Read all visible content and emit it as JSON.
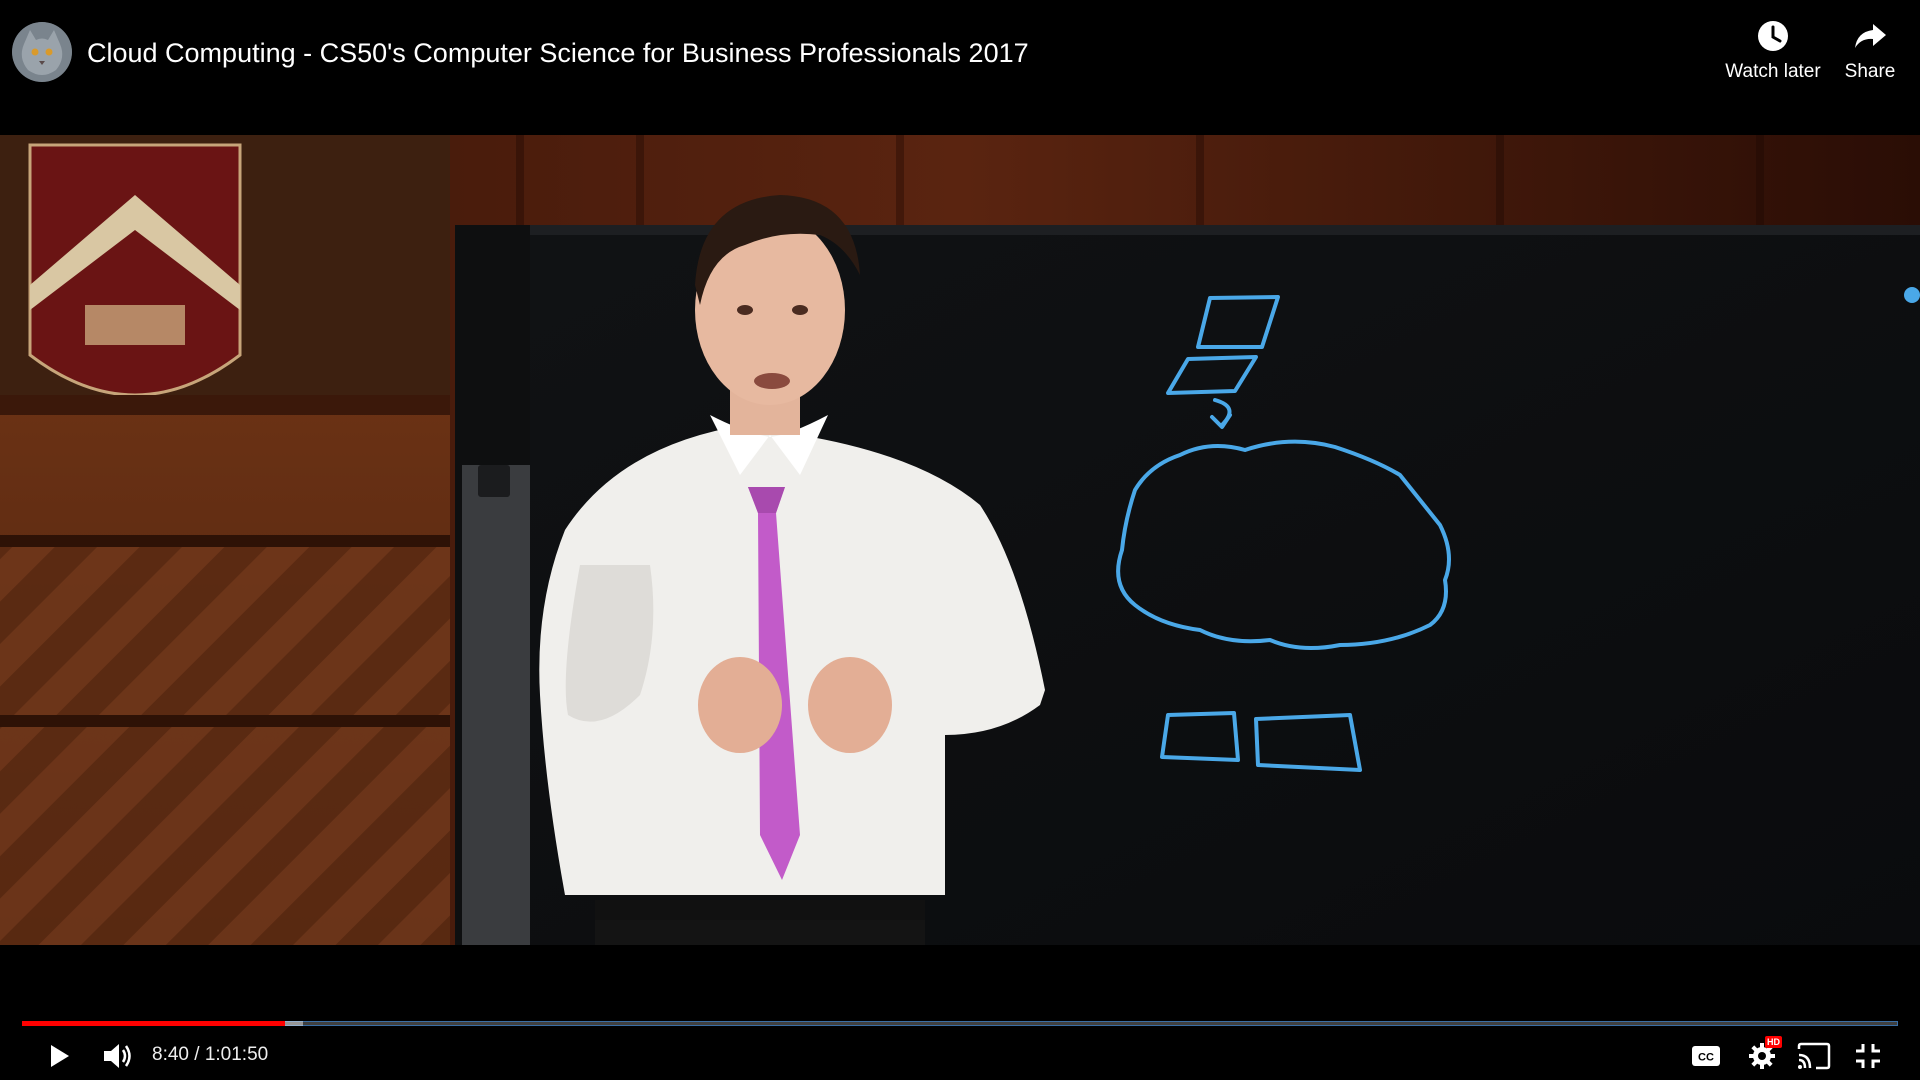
{
  "video": {
    "title": "Cloud Computing - CS50's Computer Science for Business Professionals 2017"
  },
  "top_actions": {
    "watch_later": {
      "label": "Watch later",
      "icon": "clock-icon"
    },
    "share": {
      "label": "Share",
      "icon": "share-arrow-icon"
    }
  },
  "playback": {
    "current_time": "8:40",
    "separator": " / ",
    "duration": "1:01:50",
    "played_fraction": 0.14,
    "buffered_fraction": 0.15,
    "state": "paused"
  },
  "controls": {
    "play": {
      "icon": "play-icon"
    },
    "volume": {
      "icon": "volume-icon"
    },
    "captions": {
      "icon": "cc-icon"
    },
    "settings": {
      "icon": "settings-icon",
      "badge": "HD"
    },
    "cast": {
      "icon": "cast-icon"
    },
    "fullscreen": {
      "icon": "exit-fullscreen-icon"
    }
  },
  "colors": {
    "progress_played": "#ff0000",
    "whiteboard_ink": "#4aa8e8",
    "background": "#000000"
  }
}
